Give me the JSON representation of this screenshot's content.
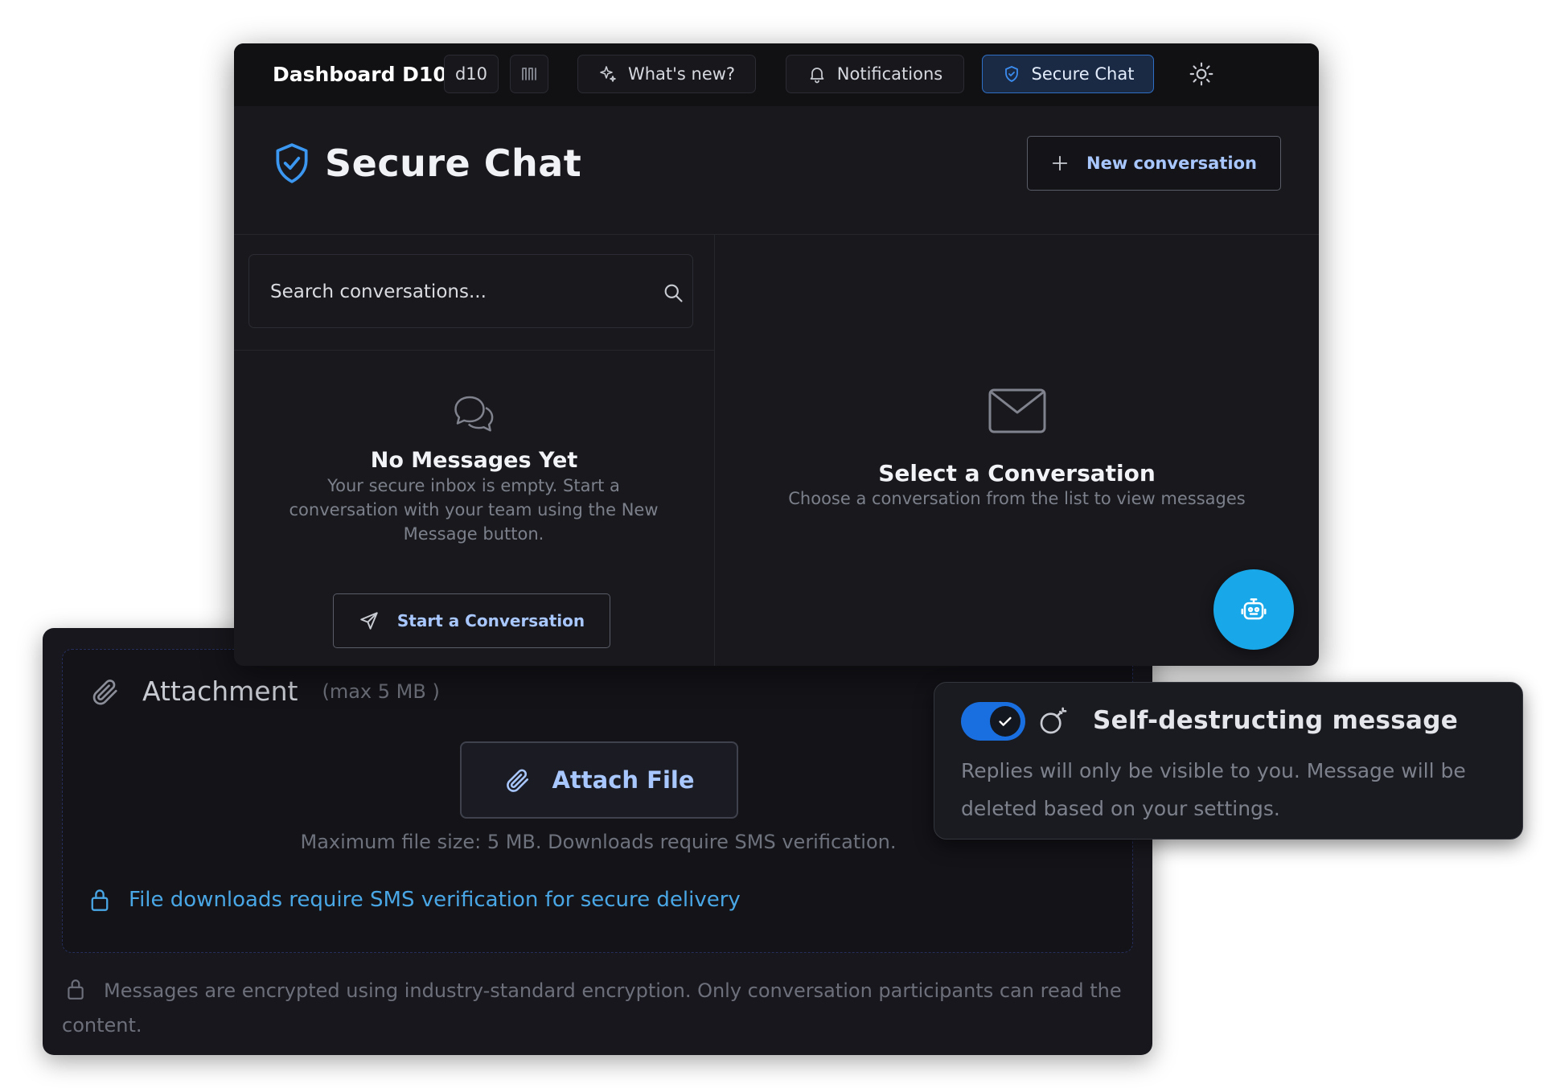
{
  "topbar": {
    "brand": "Dashboard D10",
    "badge": "d10",
    "whats_new": "What's new?",
    "notifications": "Notifications",
    "secure_chat_tab": "Secure Chat"
  },
  "page": {
    "title": "Secure Chat",
    "new_conversation": "New conversation"
  },
  "sidebar": {
    "search_placeholder": "Search conversations...",
    "empty_title": "No Messages Yet",
    "empty_desc": "Your secure inbox is empty. Start a conversation with your team using the New Message button.",
    "start_button": "Start a Conversation"
  },
  "main": {
    "select_title": "Select a Conversation",
    "select_desc": "Choose a conversation from the list to view messages"
  },
  "attachment": {
    "title": "Attachment",
    "max": "(max 5 MB )",
    "attach_button": "Attach File",
    "hint": "Maximum file size: 5 MB. Downloads require SMS verification.",
    "sms_notice": "File downloads require SMS verification for secure delivery",
    "encryption_note": "Messages are encrypted using industry-standard encryption. Only conversation participants can read the content."
  },
  "self_destruct": {
    "enabled": true,
    "title": "Self-destructing message",
    "description": "Replies will only be visible to you. Message will be deleted based on your settings."
  },
  "colors": {
    "accent": "#a9c7ff",
    "primary_blue": "#1a6fe0",
    "fab": "#18a7e8",
    "link_blue": "#4aa7e6",
    "background": "#18181d"
  },
  "icons": [
    "layout-icon",
    "sparkle-icon",
    "bell-icon",
    "shield-icon",
    "sun-icon",
    "shield-check-icon",
    "plus-icon",
    "search-icon",
    "chat-bubbles-icon",
    "send-icon",
    "mail-icon",
    "robot-icon",
    "paperclip-icon",
    "lock-icon",
    "check-icon",
    "bomb-icon"
  ]
}
